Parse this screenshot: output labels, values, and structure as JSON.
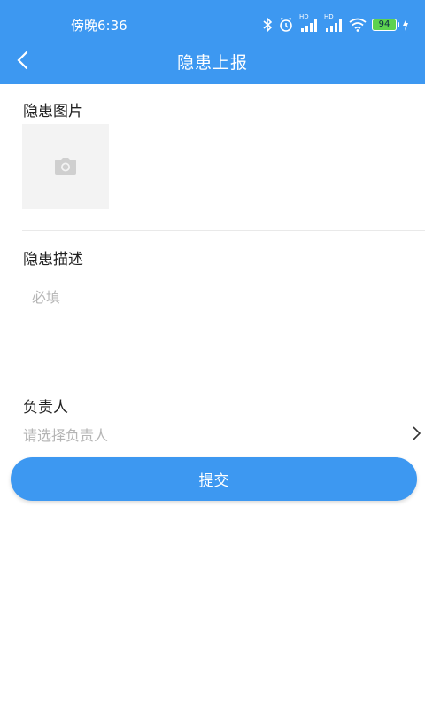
{
  "status_bar": {
    "time": "傍晚6:36",
    "battery": "94",
    "signal_labels": [
      "HD",
      "HD"
    ]
  },
  "nav": {
    "title": "隐患上报"
  },
  "form": {
    "photo_label": "隐患图片",
    "description_label": "隐患描述",
    "description_placeholder": "必填",
    "owner_label": "负责人",
    "owner_placeholder": "请选择负责人",
    "submit_label": "提交"
  },
  "colors": {
    "primary": "#3d98f1",
    "placeholder": "#b5b5b5",
    "label": "#222222",
    "photo_box_bg": "#f3f3f3"
  }
}
